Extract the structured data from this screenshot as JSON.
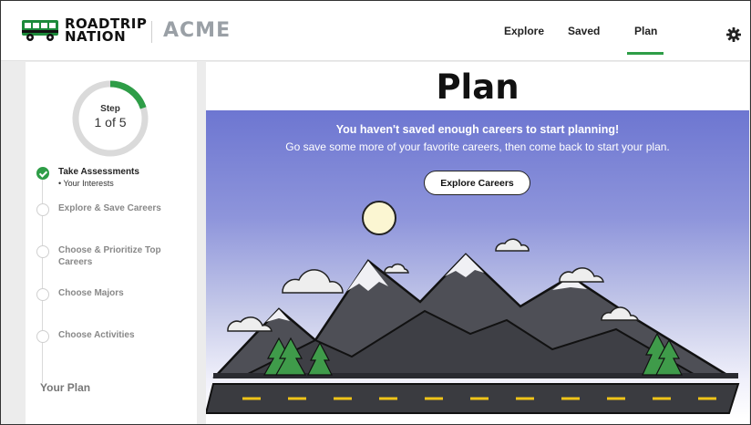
{
  "header": {
    "logo_line1": "ROADTRIP",
    "logo_line2": "NATION",
    "partner": "ACME",
    "nav": {
      "explore": "Explore",
      "saved": "Saved",
      "plan": "Plan"
    },
    "active_nav": "Plan",
    "accent_color": "#2e9d47"
  },
  "sidebar": {
    "step_label": "Step",
    "step_count": "1 of 5",
    "progress": 0.2,
    "steps": [
      {
        "title": "Take Assessments",
        "sub": "• Your Interests",
        "done": true
      },
      {
        "title": "Explore & Save Careers",
        "done": false
      },
      {
        "title": "Choose & Prioritize Top Careers",
        "done": false
      },
      {
        "title": "Choose Majors",
        "done": false
      },
      {
        "title": "Choose Activities",
        "done": false
      }
    ],
    "your_plan": "Your Plan"
  },
  "main": {
    "title": "Plan",
    "message_bold": "You haven't saved enough careers to start planning!",
    "message": "Go save some more of your favorite careers, then come back to start your plan.",
    "button": "Explore Careers"
  },
  "icons": {
    "logo": "bus-icon",
    "settings": "gear-icon",
    "step_done": "check-circle-icon"
  }
}
